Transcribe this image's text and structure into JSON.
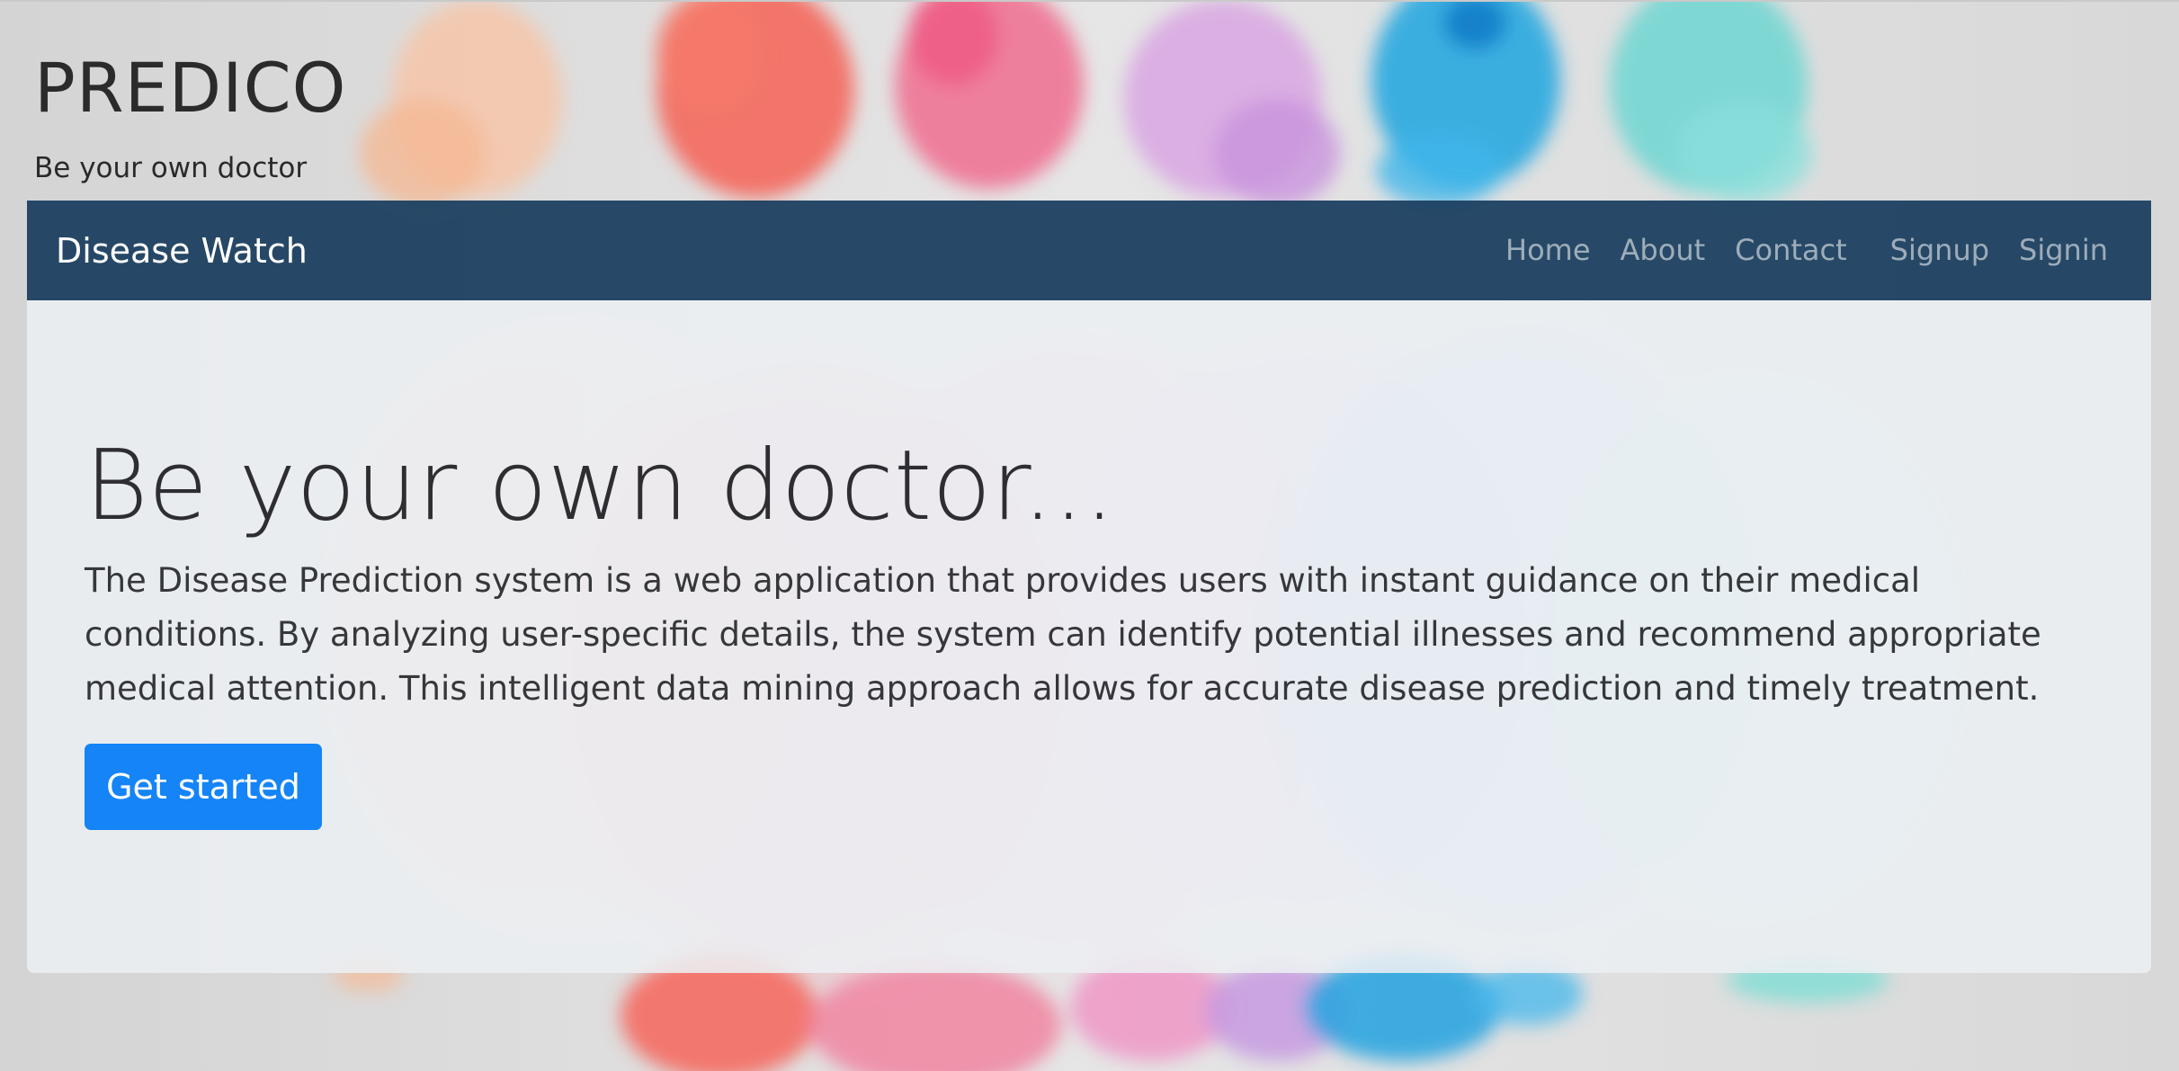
{
  "header": {
    "title": "PREDICO",
    "tagline": "Be your own doctor"
  },
  "navbar": {
    "brand": "Disease Watch",
    "links": [
      {
        "label": "Home"
      },
      {
        "label": "About"
      },
      {
        "label": "Contact"
      },
      {
        "label": "Signup"
      },
      {
        "label": "Signin"
      }
    ]
  },
  "hero": {
    "title": "Be your own doctor...",
    "description": "The Disease Prediction system is a web application that provides users with instant guidance on their medical conditions. By analyzing user-specific details, the system can identify potential illnesses and recommend appropriate medical attention. This intelligent data mining approach allows for accurate disease prediction and timely treatment.",
    "button_label": "Get started"
  },
  "colors": {
    "navbar": "#1c4060",
    "button": "#1484f7",
    "jumbotron": "#eceff3"
  }
}
